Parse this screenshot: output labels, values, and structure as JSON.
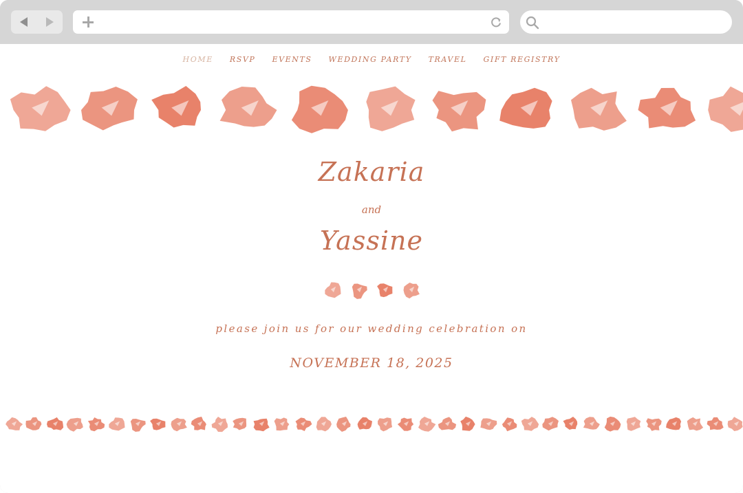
{
  "browser": {
    "back_icon": "back-arrow-icon",
    "forward_icon": "forward-arrow-icon",
    "new_tab_icon": "plus-icon",
    "reload_icon": "reload-icon",
    "search_icon": "search-icon"
  },
  "nav": {
    "items": [
      {
        "label": "HOME",
        "active": true
      },
      {
        "label": "RSVP"
      },
      {
        "label": "EVENTS"
      },
      {
        "label": "WEDDING PARTY"
      },
      {
        "label": "TRAVEL"
      },
      {
        "label": "GIFT REGISTRY"
      }
    ]
  },
  "hero": {
    "name1": "Zakaria",
    "connector": "and",
    "name2": "Yassine",
    "invite": "please join us for our wedding celebration on",
    "date": "NOVEMBER 18, 2025"
  },
  "colors": {
    "accent": "#c67255",
    "motif": "#e8826a",
    "nav_active": "#d7b4a1",
    "chrome": "#d6d6d6"
  }
}
